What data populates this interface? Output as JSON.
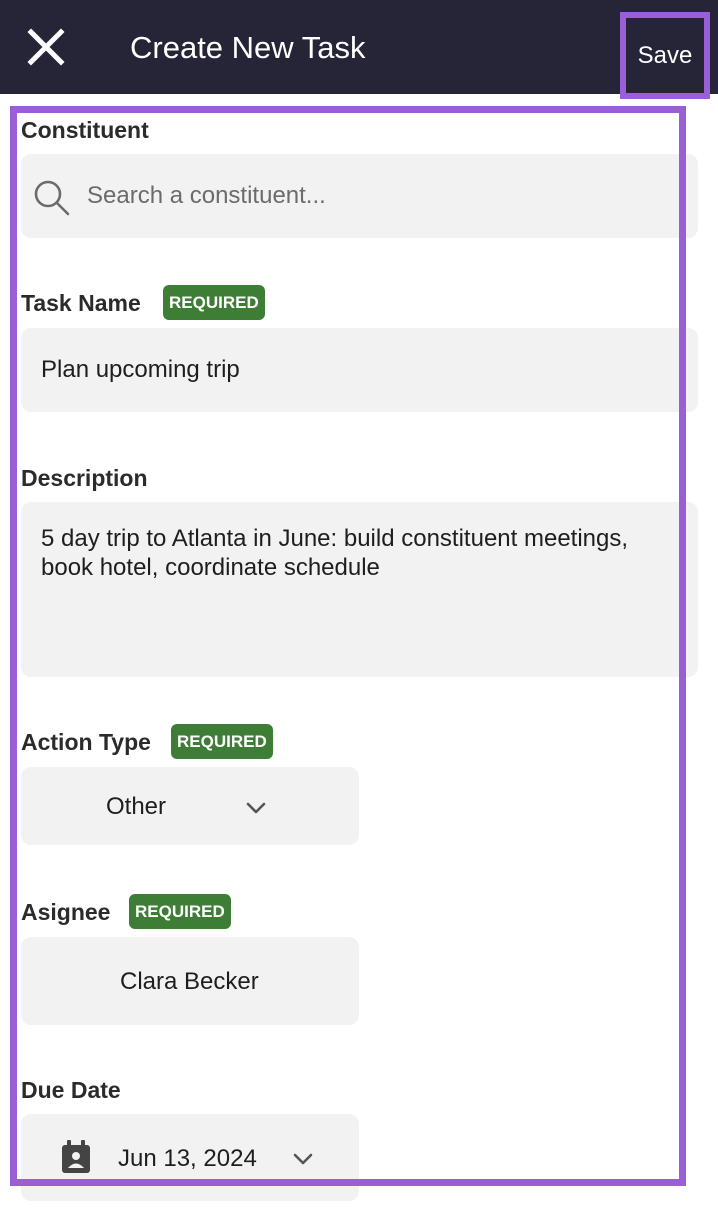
{
  "header": {
    "title": "Create New Task",
    "save_label": "Save",
    "colors": {
      "background": "#262538",
      "highlight": "#9a5fd6"
    }
  },
  "form": {
    "constituent": {
      "label": "Constituent",
      "placeholder": "Search a constituent...",
      "value": "",
      "icon": "search-icon"
    },
    "task_name": {
      "label": "Task Name",
      "badge": "REQUIRED",
      "value": "Plan upcoming trip"
    },
    "description": {
      "label": "Description",
      "value": "5 day trip to Atlanta in June: build constituent meetings, book hotel, coordinate schedule"
    },
    "action_type": {
      "label": "Action Type",
      "badge": "REQUIRED",
      "value": "Other",
      "icon": "chevron-down-icon"
    },
    "assignee": {
      "label": "Asignee",
      "badge": "REQUIRED",
      "value": "Clara Becker"
    },
    "due_date": {
      "label": "Due Date",
      "value": "Jun 13, 2024",
      "icon": "calendar-icon"
    }
  },
  "colors": {
    "required_badge": "#3e7d35",
    "field_background": "#f2f2f2"
  }
}
